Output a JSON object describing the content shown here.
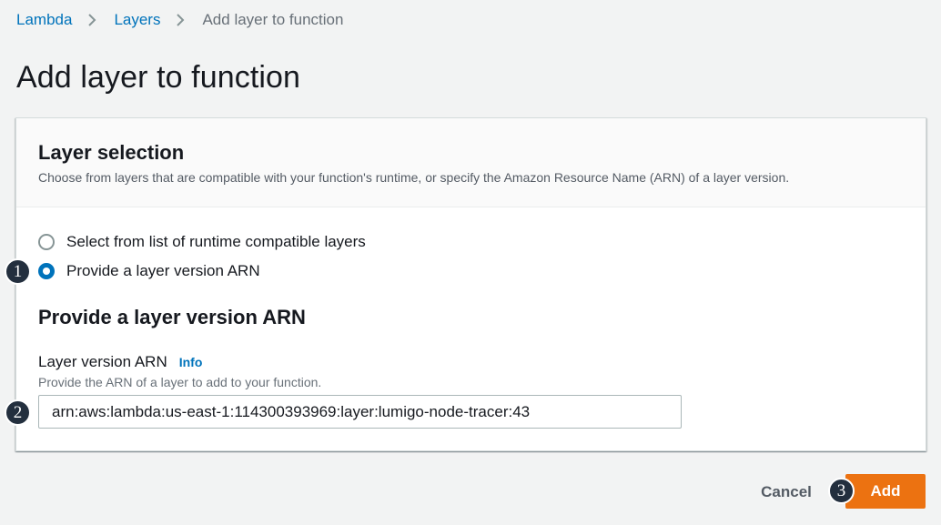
{
  "breadcrumb": {
    "items": [
      "Lambda",
      "Layers"
    ],
    "current": "Add layer to function"
  },
  "page": {
    "title": "Add layer to function"
  },
  "layer_selection": {
    "title": "Layer selection",
    "description": "Choose from layers that are compatible with your function's runtime, or specify the Amazon Resource Name (ARN) of a layer version.",
    "options": [
      {
        "label": "Select from list of runtime compatible layers",
        "selected": false
      },
      {
        "label": "Provide a layer version ARN",
        "selected": true
      }
    ]
  },
  "arn_section": {
    "heading": "Provide a layer version ARN",
    "field_label": "Layer version ARN",
    "info_link": "Info",
    "field_description": "Provide the ARN of a layer to add to your function.",
    "value": "arn:aws:lambda:us-east-1:114300393969:layer:lumigo-node-tracer:43"
  },
  "footer": {
    "cancel_label": "Cancel",
    "add_label": "Add"
  },
  "step_badges": [
    "1",
    "2",
    "3"
  ],
  "colors": {
    "link": "#0073bb",
    "primary_button": "#ec7211",
    "badge": "#232f3e",
    "background": "#f2f3f3"
  }
}
